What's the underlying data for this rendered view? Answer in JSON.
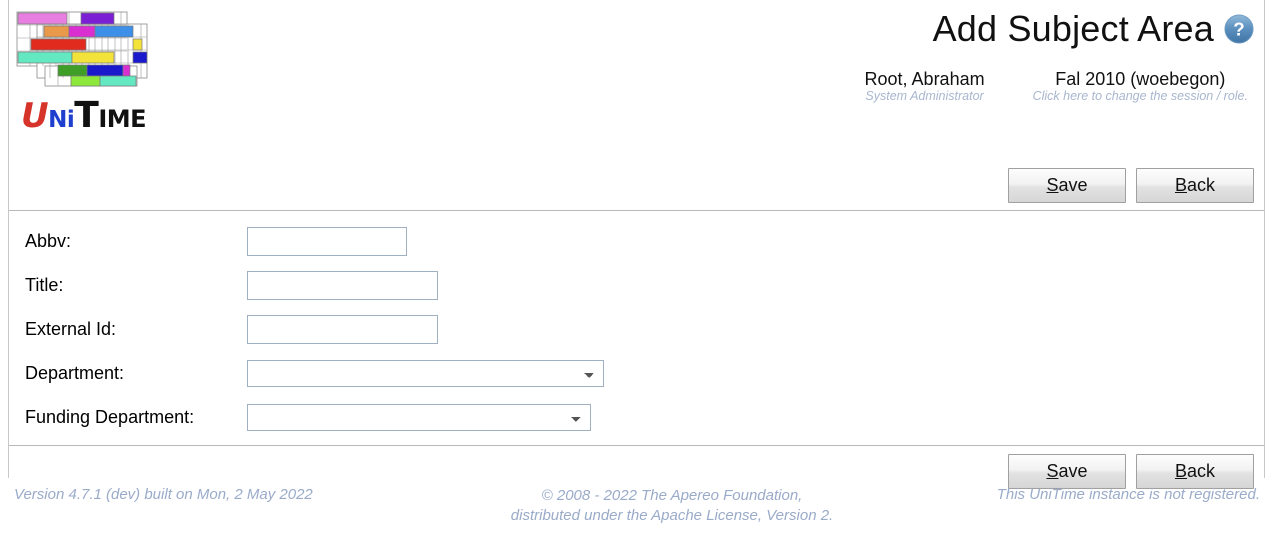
{
  "header": {
    "logo_alt": "UniTime",
    "logo_word": {
      "u": "U",
      "ni": "Ni",
      "t": "T",
      "ime": "IME"
    },
    "page_title": "Add Subject Area",
    "help_icon": "help-circle-icon",
    "user": {
      "name": "Root, Abraham",
      "role": "System Administrator"
    },
    "session": {
      "name": "Fal 2010 (woebegon)",
      "hint": "Click here to change the session / role."
    }
  },
  "toolbar": {
    "save_label": "Save",
    "save_mnemonic": "S",
    "save_rest": "ave",
    "back_label": "Back",
    "back_mnemonic": "B",
    "back_rest": "ack"
  },
  "form": {
    "fields": [
      {
        "label": "Abbv:",
        "type": "text",
        "value": "",
        "placeholder": ""
      },
      {
        "label": "Title:",
        "type": "text",
        "value": "",
        "placeholder": ""
      },
      {
        "label": "External Id:",
        "type": "text",
        "value": "",
        "placeholder": ""
      },
      {
        "label": "Department:",
        "type": "select",
        "value": "",
        "options": [
          ""
        ]
      },
      {
        "label": "Funding Department:",
        "type": "select",
        "value": "",
        "options": [
          ""
        ]
      }
    ]
  },
  "footer": {
    "version": "Version 4.7.1 (dev) built on Mon, 2 May 2022",
    "copyright_line1": "© 2008 - 2022 The Apereo Foundation,",
    "copyright_line2": "distributed under the Apache License, Version 2.",
    "registration": "This UniTime instance is not registered."
  },
  "colors": {
    "footer_text": "#9aabc9",
    "subtitle_text": "#a8b6cf",
    "field_border": "#9fb0c0",
    "divider": "#b9b9b9",
    "help_blue": "#4a82b4"
  }
}
